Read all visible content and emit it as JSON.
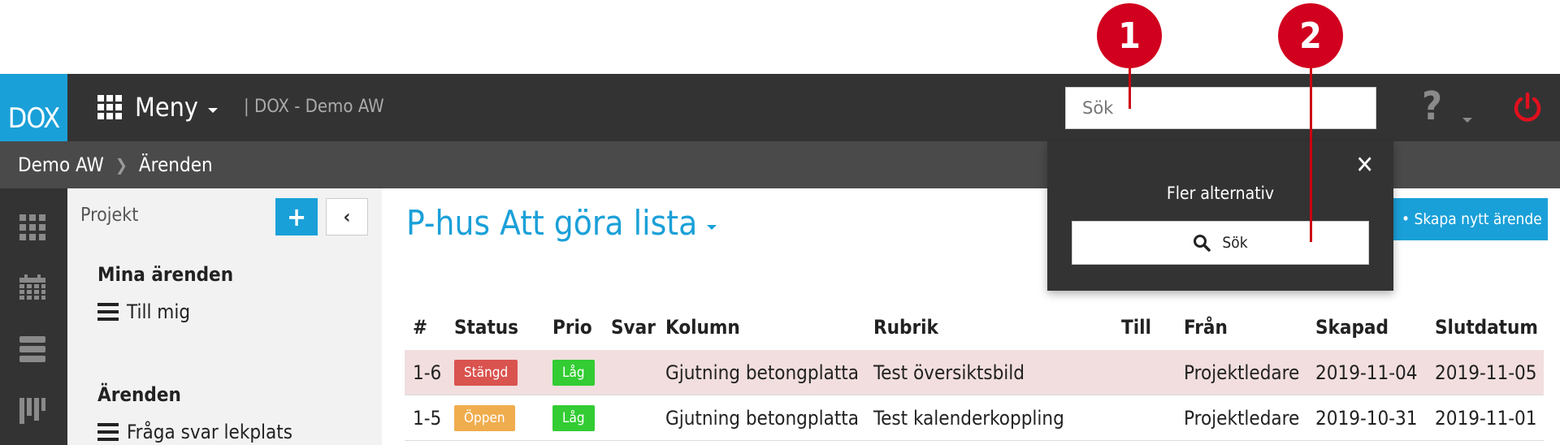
{
  "header": {
    "logo": "DOX",
    "menu_label": "Meny",
    "project_title": "| DOX - Demo AW",
    "search_placeholder": "Sök",
    "help_label": "?"
  },
  "breadcrumb": {
    "items": [
      "Demo AW",
      "Ärenden"
    ]
  },
  "sidebar": {
    "project_label": "Projekt",
    "add_label": "+",
    "collapse_label": "‹",
    "sections": [
      {
        "heading": "Mina ärenden",
        "items": [
          "Till mig"
        ]
      },
      {
        "heading": "Ärenden",
        "items": [
          "Fråga svar lekplats"
        ]
      }
    ]
  },
  "main": {
    "title": "P-hus Att göra lista",
    "create_button": "• Skapa nytt ärende"
  },
  "table": {
    "columns": [
      "#",
      "Status",
      "Prio",
      "Svar",
      "Kolumn",
      "Rubrik",
      "Till",
      "Från",
      "Skapad",
      "Slutdatum"
    ],
    "rows": [
      {
        "id": "1-6",
        "status": "Stängd",
        "status_color": "#d9534f",
        "prio": "Låg",
        "svar": "",
        "kolumn": "Gjutning betongplatta",
        "rubrik": "Test översiktsbild",
        "till": "",
        "fran": "Projektledare",
        "skapad": "2019-11-04",
        "slutdatum": "2019-11-05"
      },
      {
        "id": "1-5",
        "status": "Öppen",
        "status_color": "#f0ad4e",
        "prio": "Låg",
        "svar": "",
        "kolumn": "Gjutning betongplatta",
        "rubrik": "Test kalenderkoppling",
        "till": "",
        "fran": "Projektledare",
        "skapad": "2019-10-31",
        "slutdatum": "2019-11-01"
      }
    ]
  },
  "popup": {
    "close_label": "✕",
    "title": "Fler alternativ",
    "search_button": "Sök"
  },
  "callouts": [
    "1",
    "2"
  ],
  "colors": {
    "accent": "#1aa0d8",
    "topbar": "#333333",
    "callout": "#d1001f",
    "low_prio": "#33cc33"
  }
}
